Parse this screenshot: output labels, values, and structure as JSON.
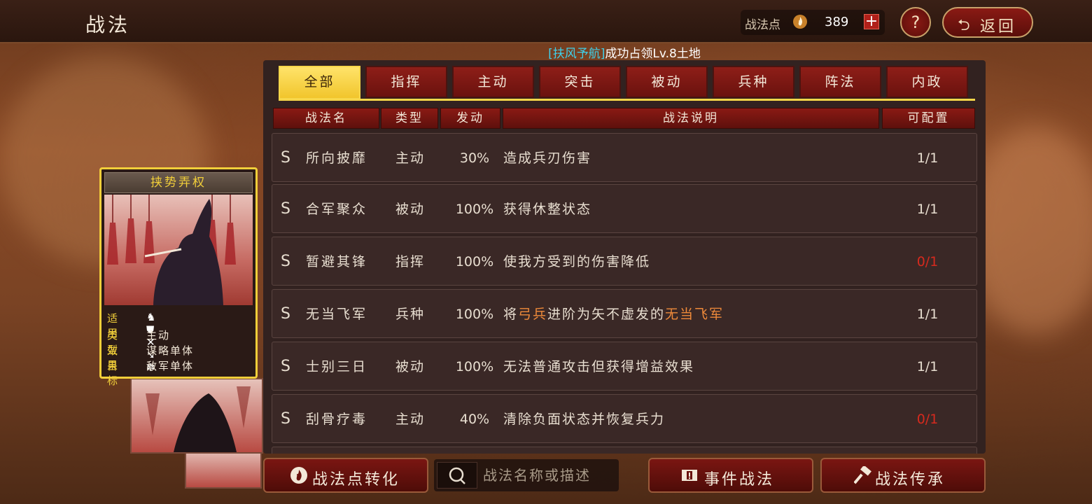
{
  "header": {
    "title": "战法",
    "points_label": "战法点",
    "points_value": "389",
    "add_label": "+",
    "help_label": "?",
    "back_label": "返回"
  },
  "notice": {
    "player": "[扶风予航]",
    "message": "成功占领Lv.8土地"
  },
  "tabs": [
    "全部",
    "指挥",
    "主动",
    "突击",
    "被动",
    "兵种",
    "阵法",
    "内政"
  ],
  "active_tab": "全部",
  "columns": {
    "name": "战法名",
    "type": "类型",
    "rate": "发动",
    "desc": "战法说明",
    "config": "可配置"
  },
  "skills": [
    {
      "grade": "S",
      "name": "所向披靡",
      "type": "主动",
      "rate": "30%",
      "desc": "造成兵刃伤害",
      "config": "1/1",
      "config_status": "ok"
    },
    {
      "grade": "S",
      "name": "合军聚众",
      "type": "被动",
      "rate": "100%",
      "desc": "获得休整状态",
      "config": "1/1",
      "config_status": "ok"
    },
    {
      "grade": "S",
      "name": "暂避其锋",
      "type": "指挥",
      "rate": "100%",
      "desc": "使我方受到的伤害降低",
      "config": "0/1",
      "config_status": "empty"
    },
    {
      "grade": "S",
      "name": "无当飞军",
      "type": "兵种",
      "rate": "100%",
      "desc_pre": "将",
      "desc_hl1": "弓兵",
      "desc_mid": "进阶为矢不虚发的",
      "desc_hl2": "无当飞军",
      "config": "1/1",
      "config_status": "ok"
    },
    {
      "grade": "S",
      "name": "士别三日",
      "type": "被动",
      "rate": "100%",
      "desc": "无法普通攻击但获得增益效果",
      "config": "1/1",
      "config_status": "ok"
    },
    {
      "grade": "S",
      "name": "刮骨疗毒",
      "type": "主动",
      "rate": "40%",
      "desc": "清除负面状态并恢复兵力",
      "config": "0/1",
      "config_status": "empty"
    }
  ],
  "card": {
    "title": "挟势弄权",
    "applies_label": "适用",
    "applies_icons": [
      "cavalry-icon",
      "shield-icon",
      "archer-icon",
      "spear-icon",
      "siege-icon"
    ],
    "type_label": "类型",
    "type_value": "主动",
    "effect_label": "效果",
    "effect_value": "谋略单体",
    "target_label": "目标",
    "target_value": "敌军单体"
  },
  "bottom": {
    "convert_label": "战法点转化",
    "search_placeholder": "战法名称或描述",
    "event_label": "事件战法",
    "inherit_label": "战法传承"
  },
  "colors": {
    "accent_yellow": "#f2cf3a",
    "highlight_orange": "#ef8a3a",
    "warning_red": "#d62a1e",
    "notice_cyan": "#3fd0ea"
  }
}
